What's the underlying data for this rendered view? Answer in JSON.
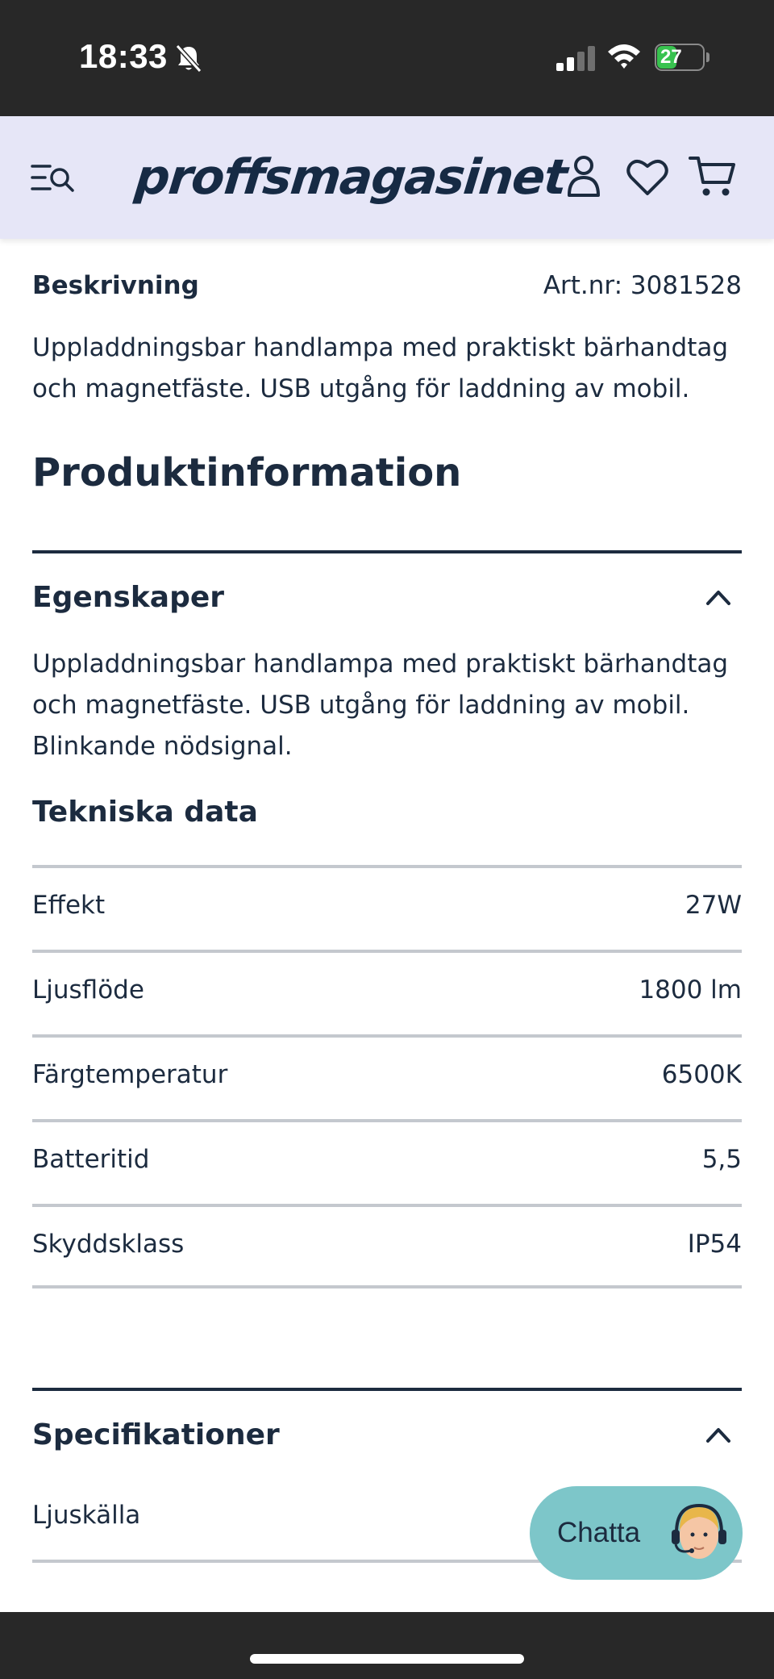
{
  "status_bar": {
    "time": "18:33",
    "battery": "27",
    "battery_color": "#38c24f"
  },
  "header": {
    "logo": "proffsmagasinet",
    "background": "#e6e6f7",
    "icons": [
      "menu-search-icon",
      "user-icon",
      "heart-icon",
      "cart-icon"
    ]
  },
  "description": {
    "title": "Beskrivning",
    "art_nr": "Art.nr: 3081528",
    "text": "Uppladdningsbar handlampa med praktiskt bärhandtag och magnetfäste. USB utgång för laddning av mobil."
  },
  "product_info": {
    "heading": "Produktinformation",
    "properties": {
      "title": "Egenskaper",
      "text": "Uppladdningsbar handlampa med praktiskt bärhandtag och magnetfäste. USB utgång för laddning av mobil. Blinkande nödsignal."
    },
    "technical": {
      "heading": "Tekniska data",
      "rows": [
        {
          "label": "Effekt",
          "value": "27W"
        },
        {
          "label": "Ljusflöde",
          "value": "1800 lm"
        },
        {
          "label": "Färgtemperatur",
          "value": "6500K"
        },
        {
          "label": "Batteritid",
          "value": "5,5"
        },
        {
          "label": "Skyddsklass",
          "value": "IP54"
        }
      ]
    },
    "specifications": {
      "title": "Specifikationer",
      "rows": [
        {
          "label": "Ljuskälla",
          "value": ""
        }
      ]
    }
  },
  "chat": {
    "label": "Chatta",
    "color": "#7dc6c9"
  }
}
